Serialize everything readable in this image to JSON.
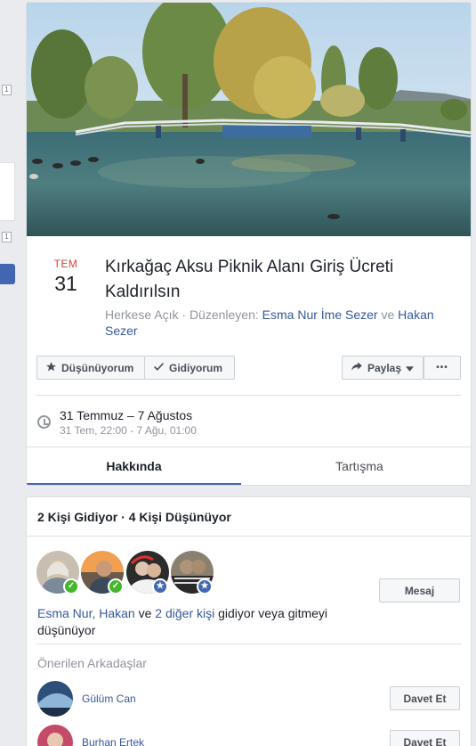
{
  "left": {
    "badge_top": "1",
    "badge_mid": "1"
  },
  "event": {
    "month": "TEM",
    "day": "31",
    "title": "Kırkağaç Aksu Piknik Alanı Giriş Ücreti Kaldırılsın",
    "privacy": "Herkese Açık",
    "separator": " · ",
    "organizer_label": "Düzenleyen: ",
    "organizer1": "Esma Nur İme Sezer",
    "and": " ve ",
    "organizer2": "Hakan Sezer",
    "buttons": {
      "interested": "Düşünüyorum",
      "going": "Gidiyorum",
      "share": "Paylaş",
      "more": "•••"
    },
    "time_main": "31 Temmuz – 7 Ağustos",
    "time_sub": "31 Tem, 22:00 - 7 Ağu, 01:00",
    "tabs": {
      "about": "Hakkında",
      "discussion": "Tartışma"
    }
  },
  "going": {
    "header": "2 Kişi Gidiyor · 4 Kişi Düşünüyor",
    "message_button": "Mesaj",
    "names_link": "Esma Nur, Hakan",
    "names_and": " ve ",
    "others_link": "2 diğer kişi",
    "tail": " gidiyor veya gitmeyi düşünüyor",
    "suggested_header": "Önerilen Arkadaşlar",
    "suggested": [
      {
        "name": "Gülüm Can",
        "button": "Davet Et"
      },
      {
        "name": "Burhan Ertek",
        "button": "Davet Et"
      }
    ]
  },
  "colors": {
    "accent": "#4267b2",
    "link": "#365899",
    "month_red": "#d93f33",
    "going_green": "#42b72a"
  },
  "icons": {
    "interested": "star-icon",
    "going": "checkmark-icon",
    "share": "share-arrow-icon",
    "time": "clock-icon"
  }
}
